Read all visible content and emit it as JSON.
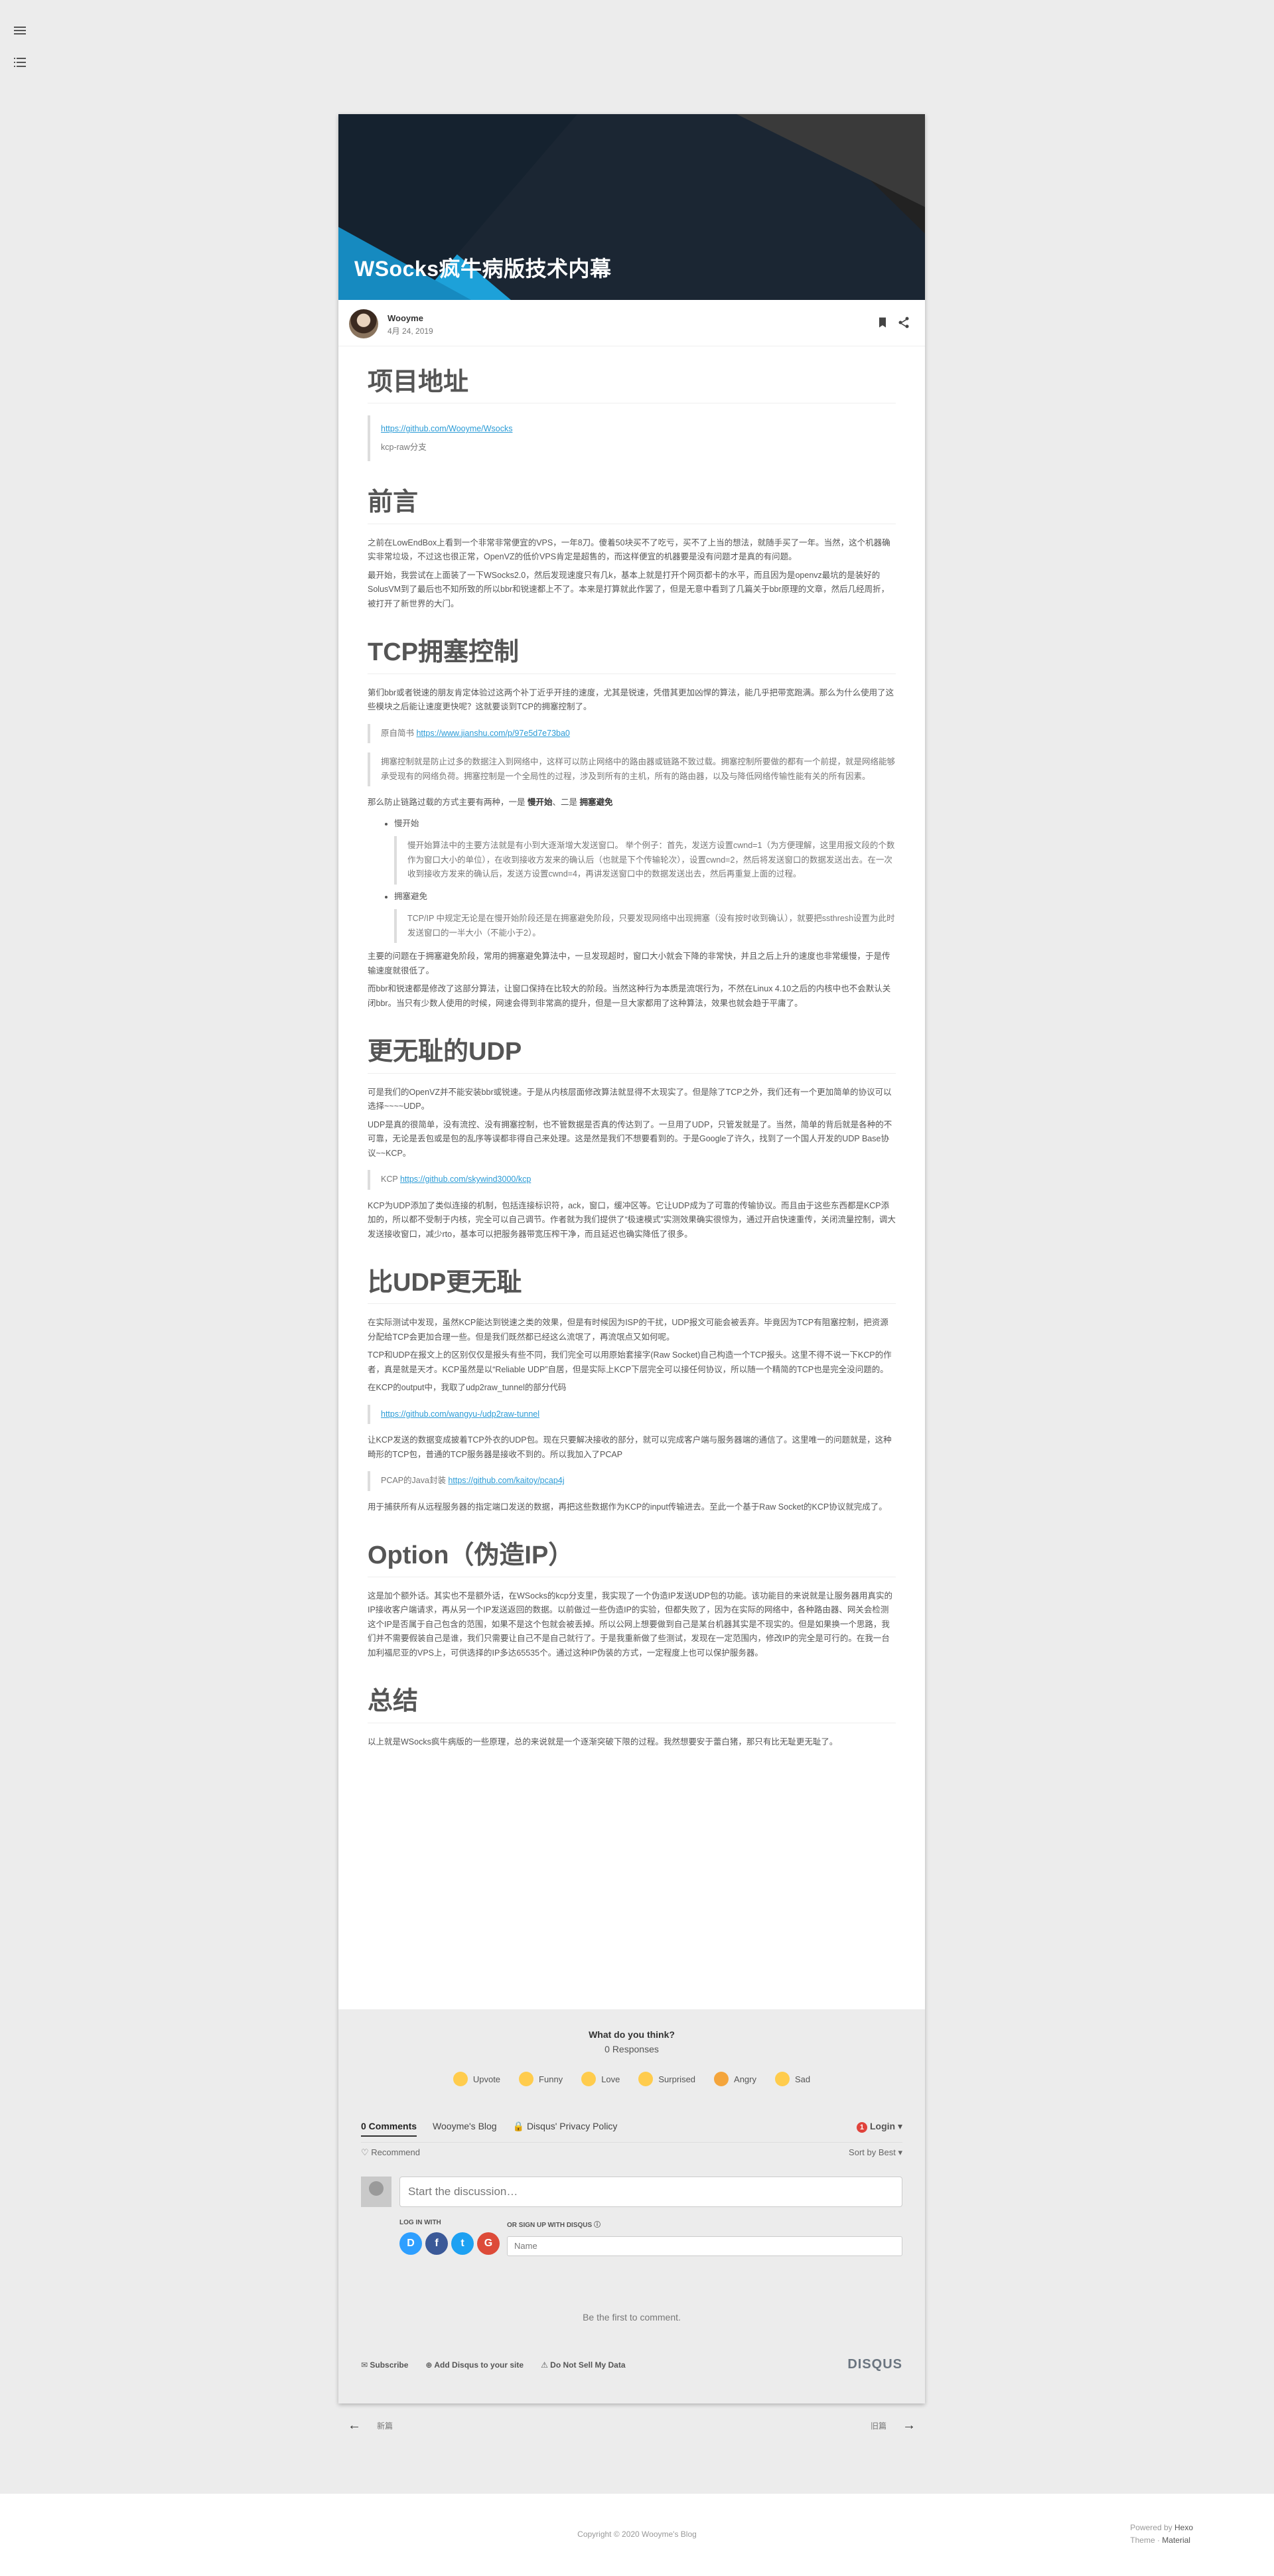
{
  "post": {
    "title": "WSocks疯牛病版技术内幕",
    "author": "Wooyme",
    "date": "4月 24, 2019"
  },
  "sections": {
    "s1": {
      "heading": "项目地址",
      "link": "https://github.com/Wooyme/Wsocks",
      "branch": "kcp-raw分支"
    },
    "s2": {
      "heading": "前言",
      "p1": "之前在LowEndBox上看到一个非常非常便宜的VPS，一年8刀。傻着50块买不了吃亏，买不了上当的想法，就随手买了一年。当然，这个机器确实非常垃圾，不过这也很正常，OpenVZ的低价VPS肯定是超售的，而这样便宜的机器要是没有问题才是真的有问题。",
      "p2": "最开始，我尝试在上面装了一下WSocks2.0，然后发现速度只有几k，基本上就是打开个网页都卡的水平，而且因为是openvz最坑的是装好的SolusVM到了最后也不知所致的所以bbr和锐速都上不了。本来是打算就此作罢了，但是无意中看到了几篇关于bbr原理的文章，然后几经周折，被打开了新世界的大门。"
    },
    "s3": {
      "heading": "TCP拥塞控制",
      "p1": "第们bbr或者锐速的朋友肯定体验过这两个补丁近乎开挂的速度，尤其是锐速，凭借其更加凶悍的算法，能几乎把带宽跑满。那么为什么使用了这些模块之后能让速度更快呢？这就要谈到TCP的拥塞控制了。",
      "quote1_prefix": "原自简书 ",
      "quote1_link": "https://www.jianshu.com/p/97e5d7e73ba0",
      "quote2": "拥塞控制就是防止过多的数据注入到网络中，这样可以防止网络中的路由器或链路不致过载。拥塞控制所要做的都有一个前提，就是网络能够承受现有的网络负荷。拥塞控制是一个全局性的过程，涉及到所有的主机，所有的路由器，以及与降低网络传输性能有关的所有因素。",
      "p2_pre": "那么防止链路过载的方式主要有两种，一是 ",
      "p2_b1": "慢开始",
      "p2_mid": "、二是 ",
      "p2_b2": "拥塞避免",
      "li1_title": "慢开始",
      "li1_quote": "慢开始算法中的主要方法就是有小到大逐渐增大发送窗口。\n举个例子：首先，发送方设置cwnd=1（为方便理解，这里用报文段的个数作为窗口大小的单位），在收到接收方发来的确认后（也就是下个传输轮次），设置cwnd=2，然后将发送窗口的数据发送出去。在一次收到接收方发来的确认后，发送方设置cwnd=4，再讲发送窗口中的数据发送出去，然后再重复上面的过程。",
      "li2_title": "拥塞避免",
      "li2_quote": "TCP/IP 中规定无论是在慢开始阶段还是在拥塞避免阶段，只要发现网络中出现拥塞（没有按时收到确认），就要把ssthresh设置为此时发送窗口的一半大小（不能小于2）。",
      "p3": "主要的问题在于拥塞避免阶段，常用的拥塞避免算法中，一旦发现超时，窗口大小就会下降的非常快，并且之后上升的速度也非常缓慢，于是传输速度就很低了。",
      "p4": "而bbr和锐速都是修改了这部分算法，让窗口保持在比较大的阶段。当然这种行为本质是流氓行为，不然在Linux 4.10之后的内核中也不会默认关闭bbr。当只有少数人使用的时候，网速会得到非常高的提升，但是一旦大家都用了这种算法，效果也就会趋于平庸了。"
    },
    "s4": {
      "heading": "更无耻的UDP",
      "p1": "可是我们的OpenVZ并不能安装bbr或锐速。于是从内核层面修改算法就显得不太现实了。但是除了TCP之外，我们还有一个更加简单的协议可以选择~~~~UDP。",
      "p2": "UDP是真的很简单，没有流控、没有拥塞控制，也不管数据是否真的传达到了。一旦用了UDP，只管发就是了。当然，简单的背后就是各种的不可靠，无论是丢包或是包的乱序等误都非得自己来处理。这是然是我们不想要看到的。于是Google了许久，找到了一个国人开发的UDP Base协议~~KCP。",
      "quote_prefix": "KCP ",
      "quote_link": "https://github.com/skywind3000/kcp",
      "p3": "KCP为UDP添加了类似连接的机制，包括连接标识符，ack，窗口，缓冲区等。它让UDP成为了可靠的传输协议。而且由于这些东西都是KCP添加的，所以都不受制于内核，完全可以自己调节。作者就为我们提供了“极速模式”实测效果确实很惊为，通过开启快速重传，关闭流量控制，调大发送接收窗口，减少rto，基本可以把服务器带宽压榨干净，而且延迟也确实降低了很多。"
    },
    "s5": {
      "heading": "比UDP更无耻",
      "p1": "在实际测试中发现，虽然KCP能达到锐速之类的效果，但是有时候因为ISP的干扰，UDP报文可能会被丢弃。毕竟因为TCP有阻塞控制，把资源分配给TCP会更加合理一些。但是我们既然都已经这么流氓了，再流氓点又如何呢。",
      "p2": "TCP和UDP在报文上的区别仅仅是报头有些不同，我们完全可以用原始套接字(Raw Socket)自己构造一个TCP报头。这里不得不说一下KCP的作者，真是就是天才。KCP虽然是以“Reliable UDP”自居，但是实际上KCP下层完全可以接任何协议，所以随一个精简的TCP也是完全没问题的。",
      "p3": "在KCP的output中，我取了udp2raw_tunnel的部分代码",
      "quote1_link": "https://github.com/wangyu-/udp2raw-tunnel",
      "p4": "让KCP发送的数据变成披着TCP外衣的UDP包。现在只要解决接收的部分，就可以完成客户端与服务器端的通信了。这里唯一的问题就是，这种畸形的TCP包，普通的TCP服务器是接收不到的。所以我加入了PCAP",
      "quote2_prefix": "PCAP的Java封装 ",
      "quote2_link": "https://github.com/kaitoy/pcap4j",
      "p5": "用于捕获所有从远程服务器的指定端口发送的数据，再把这些数据作为KCP的input传输进去。至此一个基于Raw Socket的KCP协议就完成了。"
    },
    "s6": {
      "heading": "Option（伪造IP）",
      "p1": "这是加个额外话。其实也不是额外话，在WSocks的kcp分支里，我实现了一个伪造IP发送UDP包的功能。该功能目的来说就是让服务器用真实的IP接收客户端请求，再从另一个IP发送返回的数据。以前做过一些伪造IP的实验，但都失败了，因为在实际的网络中，各种路由器、网关会检测这个IP是否属于自己包含的范围，如果不是这个包就会被丢掉。所以公网上想要做到自己是某台机器其实是不现实的。但是如果换一个思路，我们并不需要假装自己是谁，我们只需要让自己不是自己就行了。于是我重新做了些测试，发现在一定范围内，修改IP的完全是可行的。在我一台加利福尼亚的VPS上，可供选择的IP多达65535个。通过这种IP伪装的方式，一定程度上也可以保护服务器。"
    },
    "s7": {
      "heading": "总结",
      "p1": "以上就是WSocks疯牛病版的一些原理，总的来说就是一个逐渐突破下限的过程。我然想要安于蕾白猪，那只有比无耻更无耻了。"
    }
  },
  "disqus": {
    "question": "What do you think?",
    "responses": "0 Responses",
    "reactions": [
      {
        "label": "Upvote",
        "icon": "thumbs-up"
      },
      {
        "label": "Funny",
        "icon": "laughing-face"
      },
      {
        "label": "Love",
        "icon": "heart-eyes"
      },
      {
        "label": "Surprised",
        "icon": "surprised-face"
      },
      {
        "label": "Angry",
        "icon": "angry-face"
      },
      {
        "label": "Sad",
        "icon": "sad-face"
      }
    ],
    "tab_comments": "0 Comments",
    "tab_blog": "Wooyme's Blog",
    "tab_privacy": "Disqus' Privacy Policy",
    "login_badge": "1",
    "login": "Login",
    "recommend": "Recommend",
    "sort": "Sort by Best",
    "placeholder": "Start the discussion…",
    "log_in_with": "LOG IN WITH",
    "signup": "OR SIGN UP WITH DISQUS",
    "name_placeholder": "Name",
    "social": [
      "D",
      "f",
      "t",
      "G"
    ],
    "first": "Be the first to comment.",
    "subscribe": "Subscribe",
    "add_disqus": "Add Disqus to your site",
    "dnsmpi": "Do Not Sell My Data",
    "brand": "DISQUS"
  },
  "nav": {
    "prev": "新篇",
    "next": "旧篇"
  },
  "footer": {
    "copyright": "Copyright © 2020 Wooyme's Blog",
    "powered_by": "Powered by",
    "powered_name": "Hexo",
    "theme_label": "Theme",
    "theme_name": "Material"
  }
}
